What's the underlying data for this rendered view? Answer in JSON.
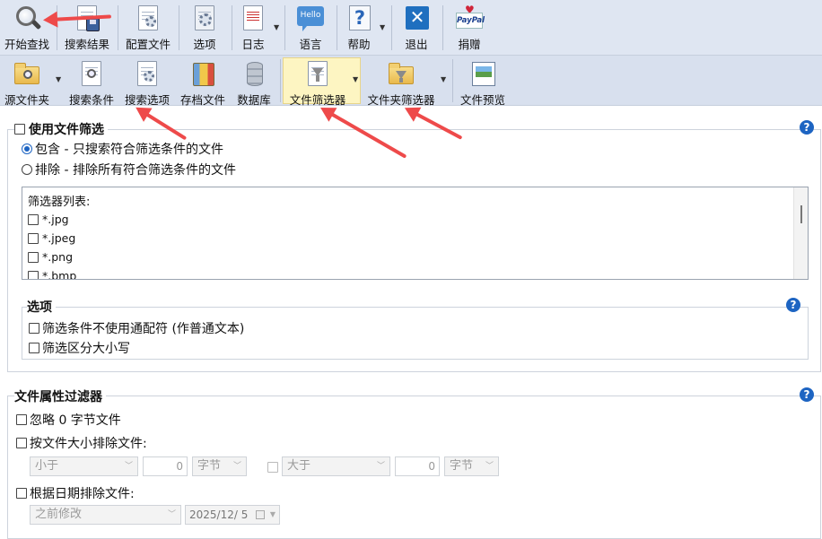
{
  "toolbar1": {
    "start_search": "开始查找",
    "search_results": "搜索结果",
    "config_file": "配置文件",
    "options": "选项",
    "log": "日志",
    "language": "语言",
    "language_icon_text": "Hello",
    "help": "帮助",
    "help_icon_text": "?",
    "exit": "退出",
    "exit_icon_text": "✕",
    "donate": "捐赠",
    "donate_icon_text": "PayPal"
  },
  "toolbar2": {
    "source_folder": "源文件夹",
    "search_criteria": "搜索条件",
    "search_options": "搜索选项",
    "archive_files": "存档文件",
    "database": "数据库",
    "file_filter": "文件筛选器",
    "folder_filter": "文件夹筛选器",
    "file_preview": "文件预览"
  },
  "file_filter_group": {
    "title": "使用文件筛选",
    "enabled": false,
    "include_label": "包含 - 只搜索符合筛选条件的文件",
    "exclude_label": "排除 - 排除所有符合筛选条件的文件",
    "mode": "include",
    "list_header": "筛选器列表:",
    "items": [
      "*.jpg",
      "*.jpeg",
      "*.png",
      "*.bmp"
    ],
    "options": {
      "title": "选项",
      "no_wildcard": "筛选条件不使用通配符 (作普通文本)",
      "case_sensitive": "筛选区分大小写"
    }
  },
  "attr_filter_group": {
    "title": "文件属性过滤器",
    "ignore_zero": "忽略 0 字节文件",
    "exclude_by_size": "按文件大小排除文件:",
    "size_less_op": "小于",
    "size_less_value": "0",
    "size_less_unit": "字节",
    "size_greater_op": "大于",
    "size_greater_value": "0",
    "size_greater_unit": "字节",
    "exclude_by_date": "根据日期排除文件:",
    "date_op": "之前修改",
    "date_value": "2025/12/  5"
  },
  "help_icon_text": "?",
  "accent_color": "#1d64c2",
  "annotation_arrow_color": "#ee4a4a"
}
